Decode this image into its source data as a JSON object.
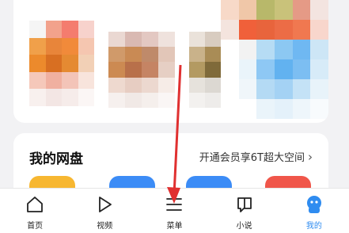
{
  "disk_section": {
    "title": "我的网盘",
    "promo": "开通会员享6T超大空间",
    "chevron": "›",
    "tile_colors": [
      "#f7b731",
      "#3c8cf6",
      "#3c8cf6",
      "#f0564a"
    ]
  },
  "tabbar": {
    "items": [
      {
        "label": "首页",
        "icon": "home-icon"
      },
      {
        "label": "视频",
        "icon": "play-icon"
      },
      {
        "label": "菜单",
        "icon": "menu-icon"
      },
      {
        "label": "小说",
        "icon": "book-icon"
      },
      {
        "label": "我的",
        "icon": "profile-icon"
      }
    ],
    "active_index": 4,
    "active_color": "#2f8cf0"
  },
  "annotation": {
    "arrow_color": "#e03030",
    "target": "菜单"
  }
}
